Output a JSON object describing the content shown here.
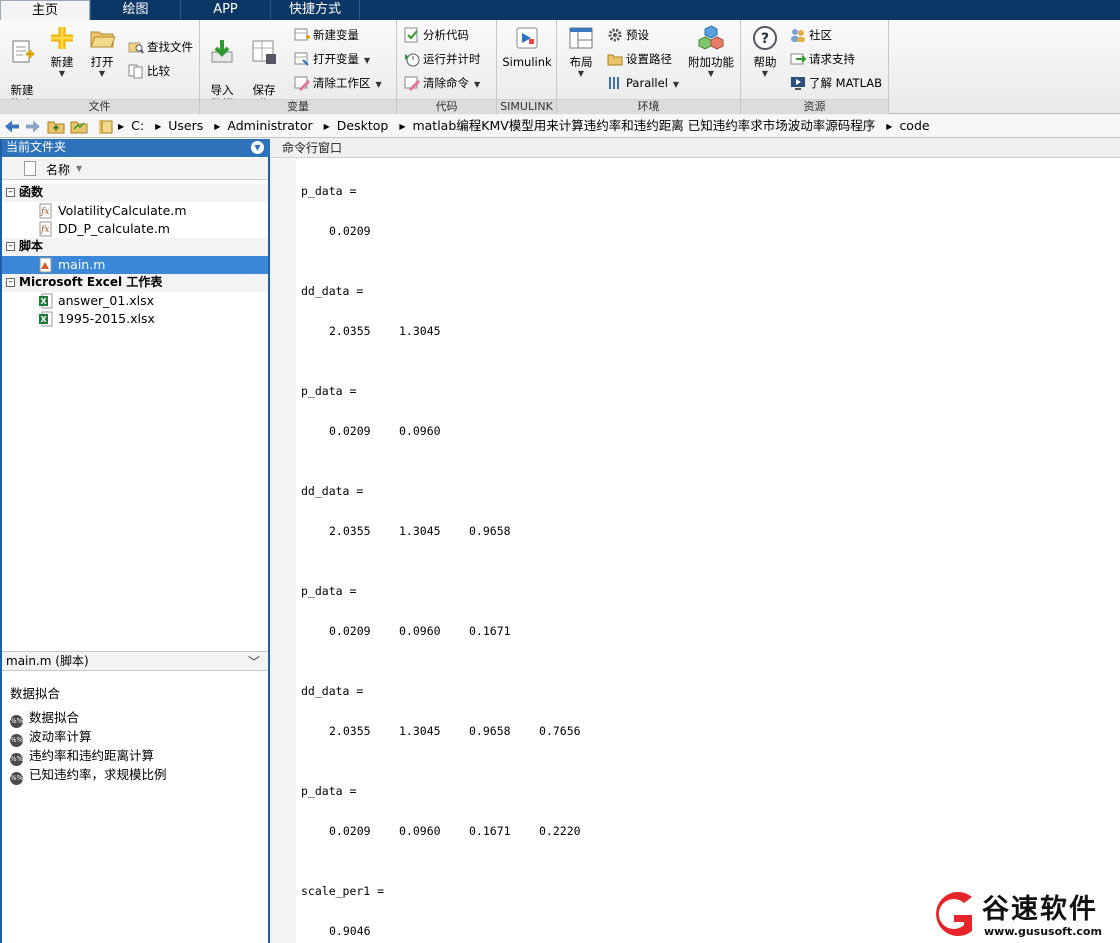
{
  "tabs": [
    {
      "label": "主页",
      "active": true
    },
    {
      "label": "绘图",
      "active": false
    },
    {
      "label": "APP",
      "active": false
    },
    {
      "label": "快捷方式",
      "active": false
    }
  ],
  "ribbon": {
    "file": {
      "label": "文件",
      "new_script": "新建\n脚本",
      "new": "新建",
      "open": "打开",
      "find_files": "查找文件",
      "compare": "比较"
    },
    "variable": {
      "label": "变量",
      "import": "导入\n数据",
      "save_ws": "保存\n工作区",
      "new_var": "新建变量",
      "open_var": "打开变量",
      "clear_ws": "清除工作区"
    },
    "code": {
      "label": "代码",
      "analyze": "分析代码",
      "run_time": "运行并计时",
      "clear_cmds": "清除命令"
    },
    "simulink": {
      "label": "SIMULINK",
      "simulink": "Simulink"
    },
    "env": {
      "label": "环境",
      "layout": "布局",
      "prefs": "预设",
      "set_path": "设置路径",
      "parallel": "Parallel",
      "addons": "附加功能"
    },
    "resources": {
      "label": "资源",
      "help": "帮助",
      "community": "社区",
      "support": "请求支持",
      "learn": "了解 MATLAB"
    }
  },
  "path": [
    "C:",
    "Users",
    "Administrator",
    "Desktop",
    "matlab编程KMV模型用来计算违约率和违约距离 已知违约率求市场波动率源码程序",
    "code"
  ],
  "left_panel": {
    "title": "当前文件夹",
    "column": "名称",
    "groups": [
      {
        "label": "函数",
        "items": [
          "VolatilityCalculate.m",
          "DD_P_calculate.m"
        ]
      },
      {
        "label": "脚本",
        "items": [
          "main.m"
        ]
      },
      {
        "label": "Microsoft Excel 工作表",
        "items": [
          "answer_01.xlsx",
          "1995-2015.xlsx"
        ]
      }
    ],
    "detail_header": "main.m  (脚本)",
    "detail_title": "数据拟合",
    "detail_items": [
      "数据拟合",
      "波动率计算",
      "违约率和违约距离计算",
      "已知违约率，求规模比例"
    ]
  },
  "command_window": {
    "title": "命令行窗口",
    "blocks": [
      {
        "name": "p_data =",
        "values": [
          "0.0209"
        ]
      },
      {
        "name": "dd_data =",
        "values": [
          "2.0355",
          "1.3045"
        ]
      },
      {
        "name": "p_data =",
        "values": [
          "0.0209",
          "0.0960"
        ]
      },
      {
        "name": "dd_data =",
        "values": [
          "2.0355",
          "1.3045",
          "0.9658"
        ]
      },
      {
        "name": "p_data =",
        "values": [
          "0.0209",
          "0.0960",
          "0.1671"
        ]
      },
      {
        "name": "dd_data =",
        "values": [
          "2.0355",
          "1.3045",
          "0.9658",
          "0.7656"
        ]
      },
      {
        "name": "p_data =",
        "values": [
          "0.0209",
          "0.0960",
          "0.1671",
          "0.2220"
        ]
      },
      {
        "name": "scale_per1 =",
        "values": [
          "0.9046"
        ]
      }
    ]
  },
  "watermark": {
    "text": "谷速软件",
    "url": "www.gususoft.com",
    "color": "#e8242b"
  }
}
